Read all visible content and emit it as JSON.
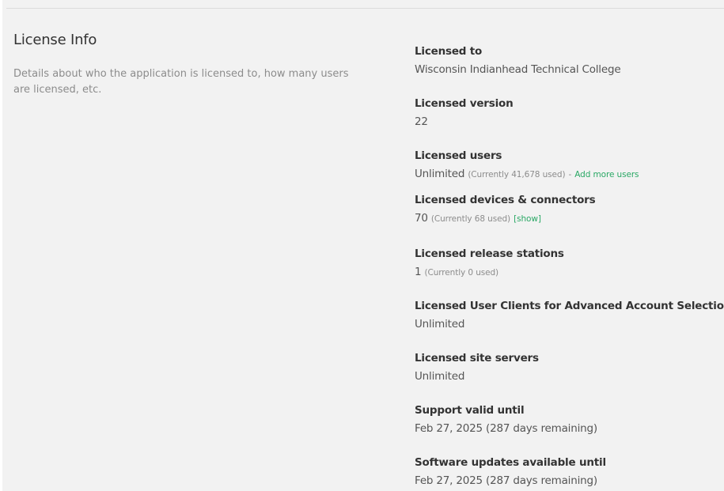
{
  "section": {
    "title": "License Info",
    "description": "Details about who the application is licensed to, how many users are licensed, etc."
  },
  "fields": {
    "licensed_to": {
      "label": "Licensed to",
      "value": "Wisconsin Indianhead Technical College"
    },
    "licensed_version": {
      "label": "Licensed version",
      "value": "22"
    },
    "licensed_users": {
      "label": "Licensed users",
      "value": "Unlimited",
      "note": "(Currently 41,678 used)",
      "separator": "-",
      "link": "Add more users"
    },
    "licensed_devices": {
      "label": "Licensed devices & connectors",
      "value": "70",
      "note": "(Currently 68 used)",
      "link": "[show]"
    },
    "licensed_release_stations": {
      "label": "Licensed release stations",
      "value": "1",
      "note": "(Currently 0 used)"
    },
    "licensed_user_clients": {
      "label": "Licensed User Clients for Advanced Account Selection",
      "value": "Unlimited"
    },
    "licensed_site_servers": {
      "label": "Licensed site servers",
      "value": "Unlimited"
    },
    "support_valid_until": {
      "label": "Support valid until",
      "value": "Feb 27, 2025 (287 days remaining)"
    },
    "software_updates_until": {
      "label": "Software updates available until",
      "value": "Feb 27, 2025 (287 days remaining)"
    }
  },
  "colors": {
    "background": "#f2f2f2",
    "link": "#2aa865",
    "label": "#333333",
    "muted": "#8c8c8c"
  }
}
